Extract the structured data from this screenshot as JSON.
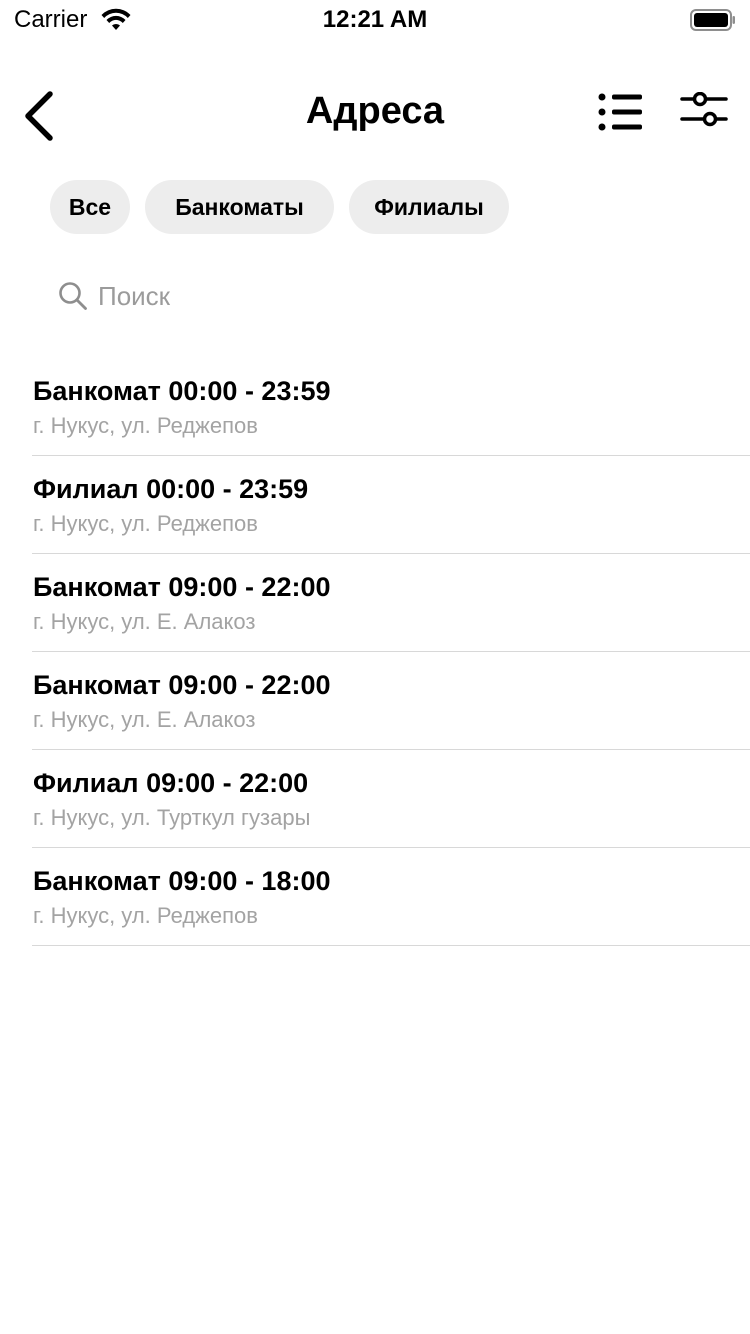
{
  "status_bar": {
    "carrier": "Carrier",
    "time": "12:21 AM"
  },
  "nav": {
    "title": "Адреса",
    "back_icon": "chevron-left-icon",
    "list_icon": "list-icon",
    "filter_icon": "sliders-icon"
  },
  "filters": {
    "chips": [
      "Все",
      "Банкоматы",
      "Филиалы"
    ]
  },
  "search": {
    "placeholder": "Поиск",
    "value": ""
  },
  "locations": [
    {
      "title": "Банкомат 00:00 - 23:59",
      "address": "г. Нукус, ул. Реджепов"
    },
    {
      "title": "Филиал 00:00 - 23:59",
      "address": "г. Нукус, ул. Реджепов"
    },
    {
      "title": "Банкомат 09:00 - 22:00",
      "address": "г. Нукус, ул. Е. Алакоз"
    },
    {
      "title": "Банкомат 09:00 - 22:00",
      "address": "г. Нукус, ул. Е. Алакоз"
    },
    {
      "title": "Филиал 09:00 - 22:00",
      "address": "г. Нукус, ул. Турткул гузары"
    },
    {
      "title": "Банкомат 09:00 - 18:00",
      "address": "г. Нукус, ул. Реджепов"
    }
  ],
  "colors": {
    "chip_bg": "#ededed",
    "subtitle": "#a3a3a3",
    "divider": "#d8d8d8"
  }
}
